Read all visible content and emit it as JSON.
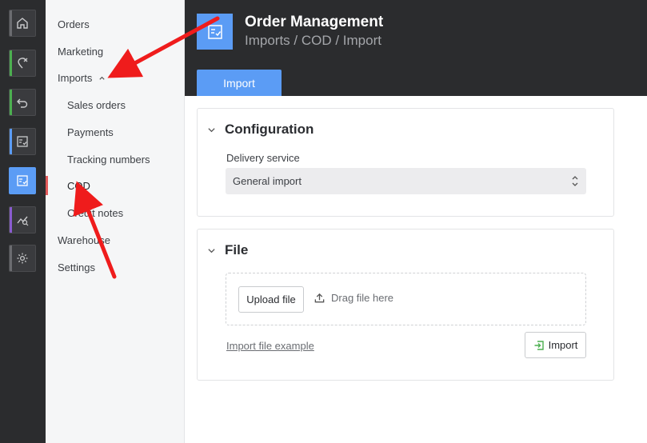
{
  "rail": {
    "items": [
      {
        "icon": "home-icon",
        "stripe": "#7a7b7e"
      },
      {
        "icon": "location-off-icon",
        "stripe": "#4caf50"
      },
      {
        "icon": "return-icon",
        "stripe": "#4caf50"
      },
      {
        "icon": "order-list-icon",
        "stripe": "#5b9cf5"
      },
      {
        "icon": "order-management-icon",
        "active": true
      },
      {
        "icon": "analytics-icon",
        "stripe": "#8a5cd0"
      },
      {
        "icon": "gear-icon",
        "stripe": "#7a7b7e"
      }
    ]
  },
  "subnav": {
    "orders": "Orders",
    "marketing": "Marketing",
    "imports": "Imports",
    "sales_orders": "Sales orders",
    "payments": "Payments",
    "tracking_numbers": "Tracking numbers",
    "cod": "COD",
    "credit_notes": "Credit notes",
    "warehouse": "Warehouse",
    "settings": "Settings"
  },
  "header": {
    "title": "Order Management",
    "breadcrumb": "Imports / COD / Import",
    "tab": "Import"
  },
  "configuration": {
    "title": "Configuration",
    "delivery_label": "Delivery service",
    "delivery_value": "General import"
  },
  "file": {
    "title": "File",
    "upload_label": "Upload file",
    "drag_label": "Drag file here",
    "example_link": "Import file example",
    "import_label": "Import"
  },
  "colors": {
    "accent": "#5b9cf5",
    "sidebar_dark": "#2b2c2e",
    "annotation_red": "#ef1c1c"
  }
}
